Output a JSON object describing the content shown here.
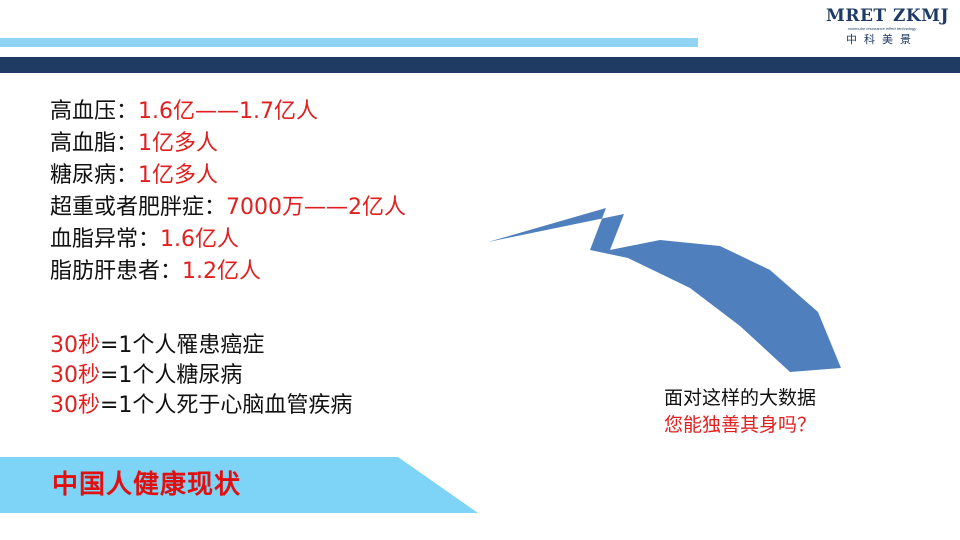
{
  "logo": {
    "main": "MRET ZKMJ",
    "sub": "molecular resonance effect technology",
    "cn": "中科美景"
  },
  "stats": [
    {
      "label": "高血压：",
      "value": "1.6亿——1.7亿人"
    },
    {
      "label": "高血脂：",
      "value": "1亿多人"
    },
    {
      "label": "糖尿病：",
      "value": "1亿多人"
    },
    {
      "label": "超重或者肥胖症：",
      "value": "7000万——2亿人"
    },
    {
      "label": "血脂异常：",
      "value": "1.6亿人"
    },
    {
      "label": "脂肪肝患者：",
      "value": "1.2亿人"
    }
  ],
  "facts": [
    {
      "time": "30秒",
      "text": "=1个人罹患癌症"
    },
    {
      "time": "30秒",
      "text": "=1个人糖尿病"
    },
    {
      "time": "30秒",
      "text": "=1个人死于心脑血管疾病"
    }
  ],
  "question": {
    "line1": "面对这样的大数据",
    "line2": "您能独善其身吗？"
  },
  "banner": {
    "title": "中国人健康现状"
  },
  "colors": {
    "dark_navy": "#1f3b63",
    "light_blue": "#8fd3f5",
    "arrow_blue": "#4f7fbd",
    "highlight_red": "#e02020"
  }
}
